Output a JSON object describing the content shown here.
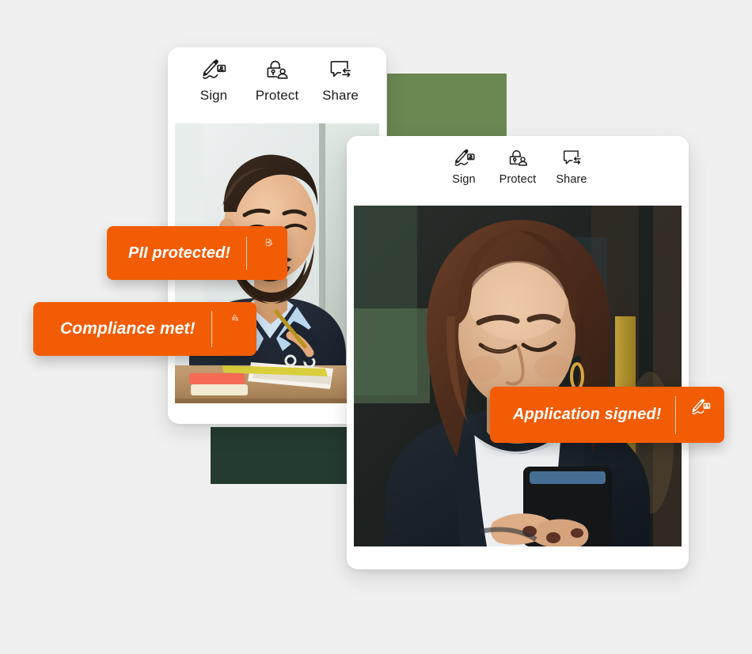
{
  "page": {
    "background_color": "#f0f0f0",
    "accent_orange": "#f25c05",
    "green_light": "#6b8752",
    "green_dark": "#243b30"
  },
  "decor": {
    "green_block_top": {
      "name": "olive-green-accent-block",
      "color": "#6b8752"
    },
    "green_block_bottom": {
      "name": "dark-green-accent-block",
      "color": "#243b30"
    }
  },
  "card_back": {
    "title": "Document app window - desktop worker",
    "toolbar": {
      "items": [
        {
          "label": "Sign",
          "icon": "sign-pen-signature-icon"
        },
        {
          "label": "Protect",
          "icon": "lock-person-protect-icon"
        },
        {
          "label": "Share",
          "icon": "speech-bubble-share-arrows-icon"
        }
      ]
    },
    "photo": {
      "alt": "Smiling bearded man in navy vest working at a desk with a monitor",
      "name": "photo-man-at-desk"
    }
  },
  "card_front": {
    "title": "Document app window - mobile user",
    "toolbar": {
      "items": [
        {
          "label": "Sign",
          "icon": "sign-pen-signature-icon"
        },
        {
          "label": "Protect",
          "icon": "lock-person-protect-icon"
        },
        {
          "label": "Share",
          "icon": "speech-bubble-share-arrows-icon"
        }
      ]
    },
    "photo": {
      "alt": "Woman with long brown hair in a dark blazer looking down at her smartphone",
      "name": "photo-woman-with-phone"
    }
  },
  "badges": [
    {
      "id": "pii-protected",
      "label": "PII protected!",
      "icon": "document-redacted-pencil-icon",
      "color": "#f25c05"
    },
    {
      "id": "compliance-met",
      "label": "Compliance met!",
      "icon": "lock-person-protect-icon",
      "color": "#f25c05"
    },
    {
      "id": "application-signed",
      "label": "Application signed!",
      "icon": "sign-pen-signature-icon",
      "color": "#f25c05"
    }
  ]
}
